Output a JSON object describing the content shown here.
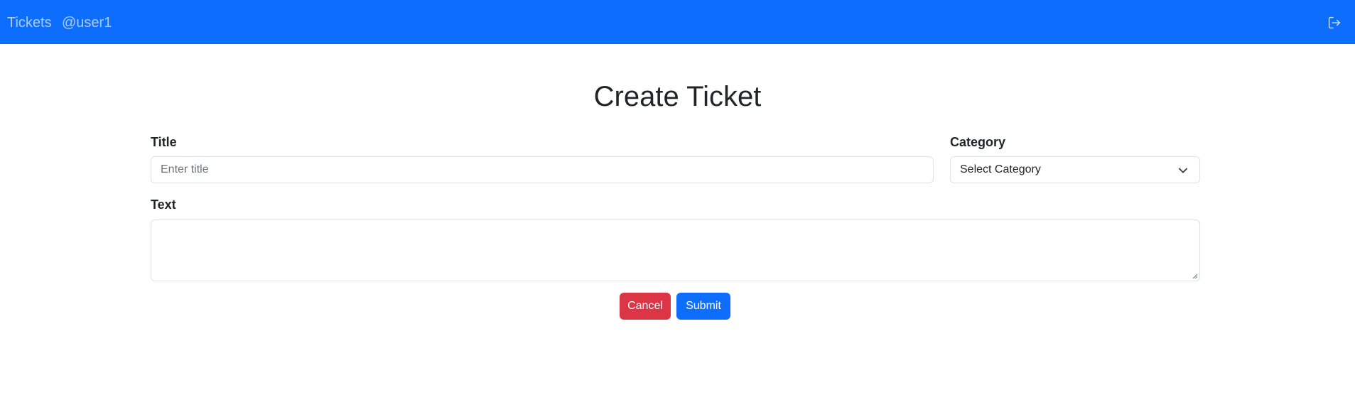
{
  "navbar": {
    "brand": "Tickets",
    "user": "@user1",
    "logout_icon": "logout-icon",
    "color": "#0d6efd"
  },
  "page": {
    "title": "Create Ticket"
  },
  "form": {
    "title_label": "Title",
    "title_placeholder": "Enter title",
    "title_value": "",
    "category_label": "Category",
    "category_selected": "Select Category",
    "text_label": "Text",
    "text_value": ""
  },
  "actions": {
    "cancel_label": "Cancel",
    "submit_label": "Submit",
    "cancel_color": "#dc3545",
    "submit_color": "#0d6efd"
  }
}
